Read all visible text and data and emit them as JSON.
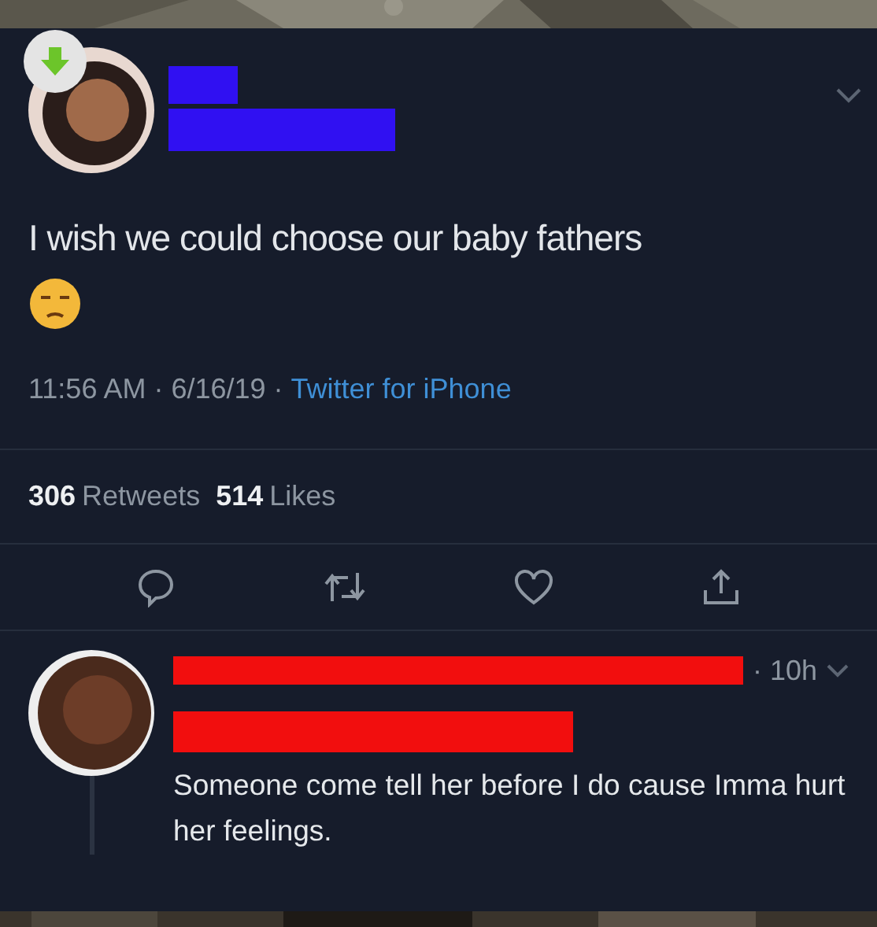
{
  "tweet": {
    "text": "I wish we could choose our baby fathers",
    "timestamp": "11:56 AM · 6/16/19 ·",
    "source": "Twitter for iPhone",
    "stats": [
      {
        "count": "306",
        "label": "Retweets"
      },
      {
        "count": "514",
        "label": "Likes"
      }
    ]
  },
  "reply": {
    "time": "· 10h",
    "text": "Someone come tell her before I do cause Imma hurt her feelings."
  }
}
